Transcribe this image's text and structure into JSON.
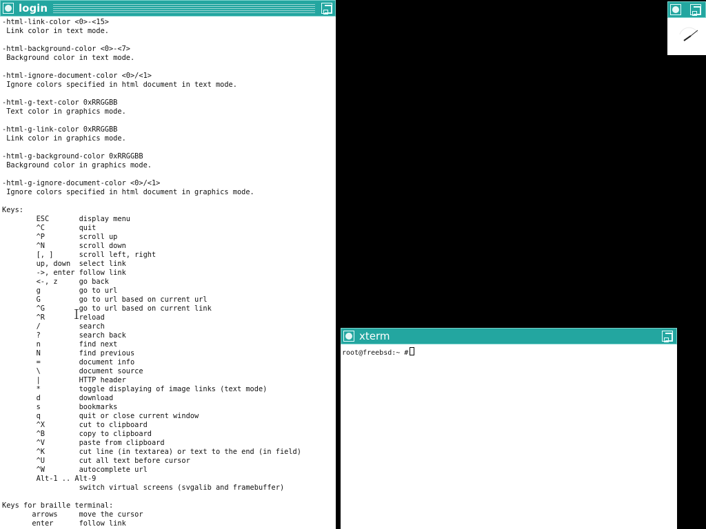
{
  "login_window": {
    "title": "login",
    "content_lines": [
      "-html-link-color <0>-<15>",
      " Link color in text mode.",
      "",
      "-html-background-color <0>-<7>",
      " Background color in text mode.",
      "",
      "-html-ignore-document-color <0>/<1>",
      " Ignore colors specified in html document in text mode.",
      "",
      "-html-g-text-color 0xRRGGBB",
      " Text color in graphics mode.",
      "",
      "-html-g-link-color 0xRRGGBB",
      " Link color in graphics mode.",
      "",
      "-html-g-background-color 0xRRGGBB",
      " Background color in graphics mode.",
      "",
      "-html-g-ignore-document-color <0>/<1>",
      " Ignore colors specified in html document in graphics mode.",
      "",
      "Keys:",
      "        ESC       display menu",
      "        ^C        quit",
      "        ^P        scroll up",
      "        ^N        scroll down",
      "        [, ]      scroll left, right",
      "        up, down  select link",
      "        ->, enter follow link",
      "        <-, z     go back",
      "        g         go to url",
      "        G         go to url based on current url",
      "        ^G        go to url based on current link",
      "        ^R        reload",
      "        /         search",
      "        ?         search back",
      "        n         find next",
      "        N         find previous",
      "        =         document info",
      "        \\         document source",
      "        |         HTTP header",
      "        *         toggle displaying of image links (text mode)",
      "        d         download",
      "        s         bookmarks",
      "        q         quit or close current window",
      "        ^X        cut to clipboard",
      "        ^B        copy to clipboard",
      "        ^V        paste from clipboard",
      "        ^K        cut line (in textarea) or text to the end (in field)",
      "        ^U        cut all text before cursor",
      "        ^W        autocomplete url",
      "        Alt-1 .. Alt-9",
      "                  switch virtual screens (svgalib and framebuffer)",
      "",
      "Keys for braille terminal:",
      "       arrows     move the cursor",
      "       enter      follow link"
    ]
  },
  "xterm_window": {
    "title": "xterm",
    "prompt": "root@freebsd:~ #"
  },
  "clock_window": {},
  "colors": {
    "titlebar": "#23a6a0",
    "desktop": "#000000",
    "window_bg": "#ffffff"
  },
  "icons": [
    "window-menu-icon",
    "maximize-icon",
    "text-cursor-icon"
  ]
}
